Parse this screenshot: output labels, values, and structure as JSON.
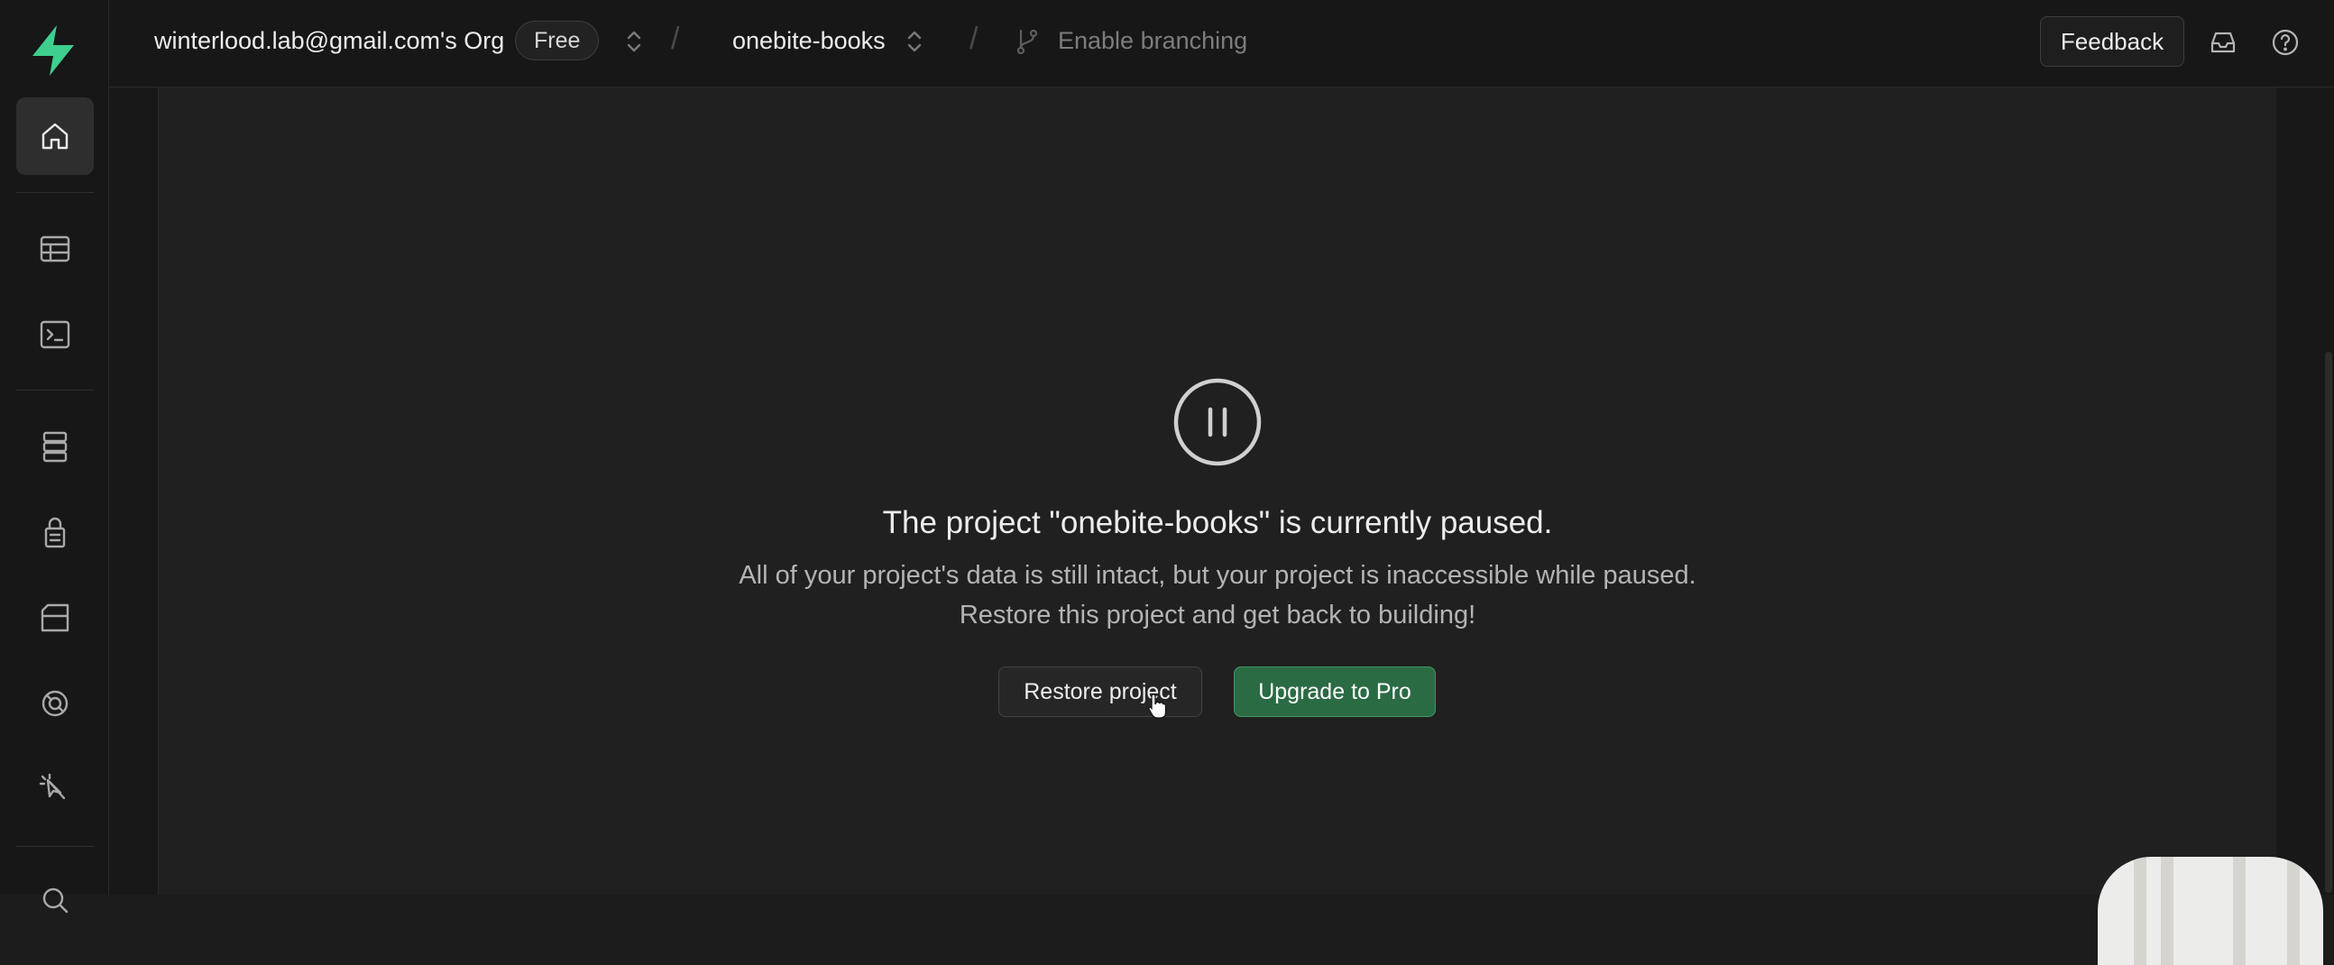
{
  "org": {
    "name": "winterlood.lab@gmail.com's Org",
    "plan_badge": "Free"
  },
  "project": {
    "name": "onebite-books"
  },
  "branching": {
    "label": "Enable branching"
  },
  "topbar": {
    "feedback_label": "Feedback"
  },
  "sidebar": {
    "items": [
      {
        "name": "home",
        "icon": "home-icon",
        "active": true
      },
      {
        "name": "table-editor",
        "icon": "table-icon"
      },
      {
        "name": "sql-editor",
        "icon": "terminal-icon"
      },
      {
        "name": "database",
        "icon": "database-icon"
      },
      {
        "name": "authentication",
        "icon": "lock-icon"
      },
      {
        "name": "storage",
        "icon": "archive-icon"
      },
      {
        "name": "realtime",
        "icon": "realtime-icon"
      },
      {
        "name": "advisors",
        "icon": "pointer-icon"
      }
    ]
  },
  "paused": {
    "title": "The project \"onebite-books\" is currently paused.",
    "description_line1": "All of your project's data is still intact, but your project is inaccessible while paused.",
    "description_line2": "Restore this project and get back to building!",
    "restore_label": "Restore project",
    "upgrade_label": "Upgrade to Pro"
  },
  "colors": {
    "brand_green": "#3ecf8e",
    "upgrade_button": "#2b6b44",
    "background": "#1c1c1c"
  }
}
